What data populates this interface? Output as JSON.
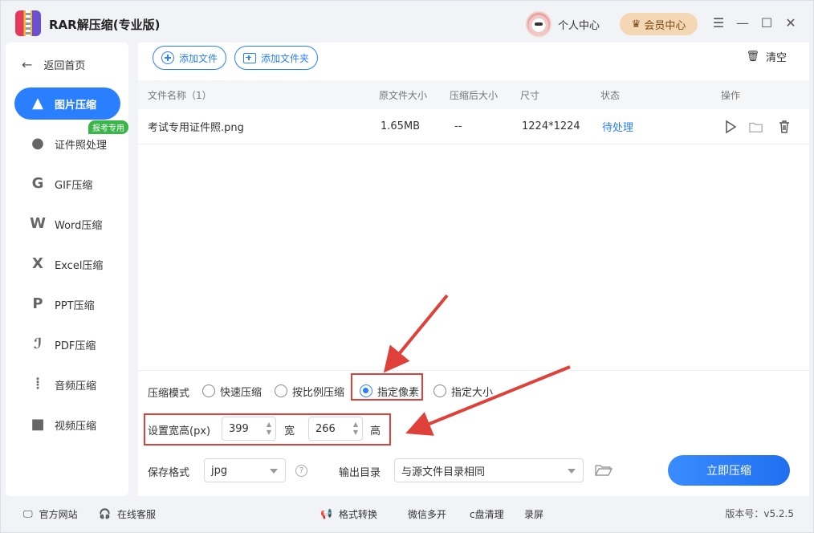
{
  "app": {
    "title": "RAR解压缩(专业版)",
    "user_center": "个人中心",
    "vip_center": "会员中心"
  },
  "sidebar": {
    "back_label": "返回首页",
    "badge": "报考专用",
    "items": [
      {
        "label": "图片压缩",
        "icon": "image-icon",
        "active": true
      },
      {
        "label": "证件照处理",
        "icon": "id-photo-icon"
      },
      {
        "label": "GIF压缩",
        "icon": "gif-icon"
      },
      {
        "label": "Word压缩",
        "icon": "word-icon"
      },
      {
        "label": "Excel压缩",
        "icon": "excel-icon"
      },
      {
        "label": "PPT压缩",
        "icon": "ppt-icon"
      },
      {
        "label": "PDF压缩",
        "icon": "pdf-icon"
      },
      {
        "label": "音频压缩",
        "icon": "audio-icon"
      },
      {
        "label": "视频压缩",
        "icon": "video-icon"
      }
    ]
  },
  "toolbar": {
    "add_file": "添加文件",
    "add_folder": "添加文件夹",
    "clear": "清空"
  },
  "table": {
    "headers": {
      "name": "文件名称（1）",
      "orig_size": "原文件大小",
      "comp_size": "压缩后大小",
      "dimensions": "尺寸",
      "status": "状态",
      "actions": "操作"
    },
    "rows": [
      {
        "name": "考试专用证件照.png",
        "orig_size": "1.65MB",
        "comp_size": "--",
        "dimensions": "1224*1224",
        "status": "待处理"
      }
    ]
  },
  "settings": {
    "mode_label": "压缩模式",
    "modes": [
      "快速压缩",
      "按比例压缩",
      "指定像素",
      "指定大小"
    ],
    "selected_mode": "指定像素",
    "px_label": "设置宽高(px)",
    "width_value": "399",
    "width_unit": "宽",
    "height_value": "266",
    "height_unit": "高",
    "format_label": "保存格式",
    "format_value": "jpg",
    "output_label": "输出目录",
    "output_value": "与源文件目录相同",
    "start_button": "立即压缩"
  },
  "statusbar": {
    "website": "官方网站",
    "support": "在线客服",
    "format_convert": "格式转换",
    "wechat_multi": "微信多开",
    "c_clean": "c盘清理",
    "record": "录屏",
    "version": "版本号：v5.2.5"
  },
  "colors": {
    "accent": "#2a7fff",
    "annotation": "#e0403a",
    "badge_green": "#3ab54a",
    "vip_bg": "#f4d7b5"
  }
}
